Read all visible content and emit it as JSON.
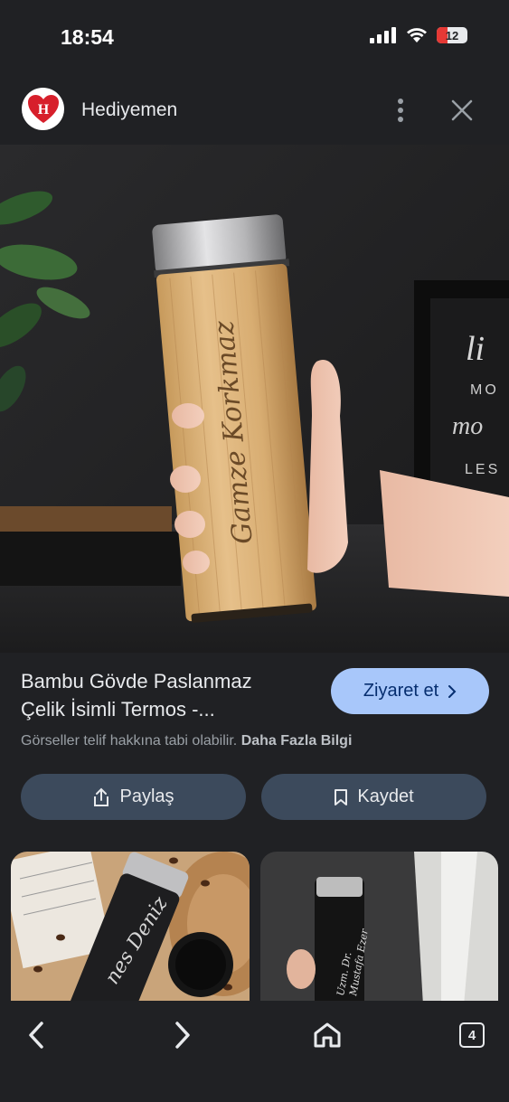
{
  "status": {
    "time": "18:54",
    "battery": "12"
  },
  "header": {
    "site_name": "Hediyemen",
    "logo_letter": "H"
  },
  "hero": {
    "engraving": "Gamze Korkmaz",
    "frame_words": [
      "li",
      "MO",
      "mo",
      "LES"
    ]
  },
  "product": {
    "title_line1": "Bambu Gövde Paslanmaz",
    "title_line2": "Çelik İsimli Termos -...",
    "visit_label": "Ziyaret et",
    "copyright_text": "Görseller telif hakkına tabi olabilir.",
    "more_info": "Daha Fazla Bilgi"
  },
  "actions": {
    "share_label": "Paylaş",
    "save_label": "Kaydet"
  },
  "related": {
    "thumb1_engraving": "nes Deniz",
    "thumb2_engraving_line1": "Uzm. Dr.",
    "thumb2_engraving_line2": "Mustafa Ezer"
  },
  "nav": {
    "tab_count": "4"
  }
}
